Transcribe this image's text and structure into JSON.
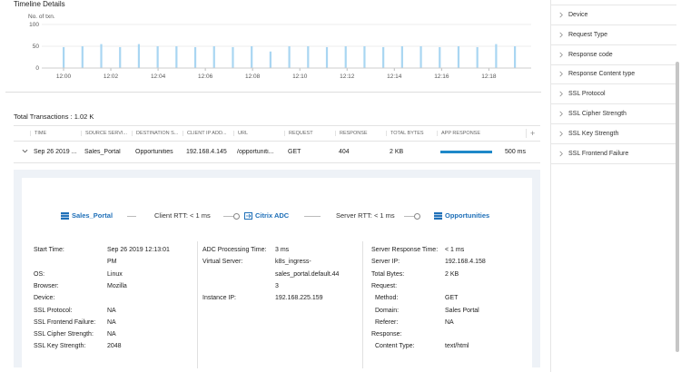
{
  "timeline": {
    "title": "Timeline Details",
    "y_axis_title": "No. of txn."
  },
  "chart_data": {
    "type": "bar",
    "ylabel": "No. of txn.",
    "xlabel": "",
    "ylim": [
      0,
      100
    ],
    "yticks": [
      0,
      50,
      100
    ],
    "xtick_labels": [
      "12:00",
      "12:02",
      "12:04",
      "12:06",
      "12:08",
      "12:10",
      "12:12",
      "12:14",
      "12:16",
      "12:18"
    ],
    "bar_color": "#a9d6f2",
    "values": [
      48,
      50,
      55,
      48,
      55,
      50,
      50,
      48,
      50,
      48,
      50,
      38,
      50,
      50,
      48,
      50,
      50,
      48,
      50,
      50,
      48,
      50,
      48,
      55,
      50
    ]
  },
  "total_transactions": "Total Transactions : 1.02 K",
  "table": {
    "columns": [
      "TIME",
      "SOURCE SERVI...",
      "DESTINATION S...",
      "CLIENT IP ADD...",
      "URL",
      "REQUEST",
      "RESPONSE",
      "TOTAL BYTES",
      "APP RESPONSE"
    ],
    "row": {
      "time": "Sep 26 2019 ...",
      "source": "Sales_Portal",
      "destination": "Opportunities",
      "client_ip": "192.168.4.145",
      "url": "/opportuniti...",
      "request": "GET",
      "response": "404",
      "total_bytes": "2 KB",
      "app_response": "500 ms",
      "app_response_fill": 1.0
    },
    "plus": "+"
  },
  "flow": {
    "source": "Sales_Portal",
    "client_rtt": "Client RTT: < 1 ms",
    "adc": "Citrix ADC",
    "server_rtt": "Server RTT: < 1 ms",
    "destination": "Opportunities"
  },
  "details": {
    "col1": [
      {
        "k": "Start Time:",
        "v": "Sep 26 2019 12:13:01"
      },
      {
        "k": "",
        "v": "PM"
      },
      {
        "k": "OS:",
        "v": "Linux"
      },
      {
        "k": "Browser:",
        "v": "Mozilla"
      },
      {
        "k": "Device:",
        "v": ""
      },
      {
        "k": "SSL Protocol:",
        "v": "NA"
      },
      {
        "k": "SSL Frontend Failure:",
        "v": "NA"
      },
      {
        "k": "SSL Cipher Strength:",
        "v": "NA"
      },
      {
        "k": "SSL Key Strength:",
        "v": "2048"
      }
    ],
    "col2": [
      {
        "k": "ADC Processing Time:",
        "v": "3 ms"
      },
      {
        "k": "Virtual Server:",
        "v": "k8s_ingress-"
      },
      {
        "k": "",
        "v": "sales_portal.default.44"
      },
      {
        "k": "",
        "v": "3"
      },
      {
        "k": "Instance IP:",
        "v": "192.168.225.159"
      }
    ],
    "col3": [
      {
        "k": "Server Response Time:",
        "v": "< 1 ms"
      },
      {
        "k": "Server IP:",
        "v": "192.168.4.158"
      },
      {
        "k": "Total Bytes:",
        "v": "2 KB"
      },
      {
        "k": "Request:",
        "v": ""
      },
      {
        "k": "Method:",
        "v": "GET"
      },
      {
        "k": "Domain:",
        "v": "Sales Portal"
      },
      {
        "k": "Referer:",
        "v": "NA"
      },
      {
        "k": "Response:",
        "v": ""
      },
      {
        "k": "Content Type:",
        "v": "text/html"
      }
    ]
  },
  "filters": [
    "Device",
    "Request Type",
    "Response code",
    "Response Content type",
    "SSL Protocol",
    "SSL Cipher Strength",
    "SSL Key Strength",
    "SSL Frontend Failure"
  ],
  "colors": {
    "accent": "#1e6fb8",
    "bar": "#a9d6f2",
    "resp_fill": "#1e88c9"
  }
}
